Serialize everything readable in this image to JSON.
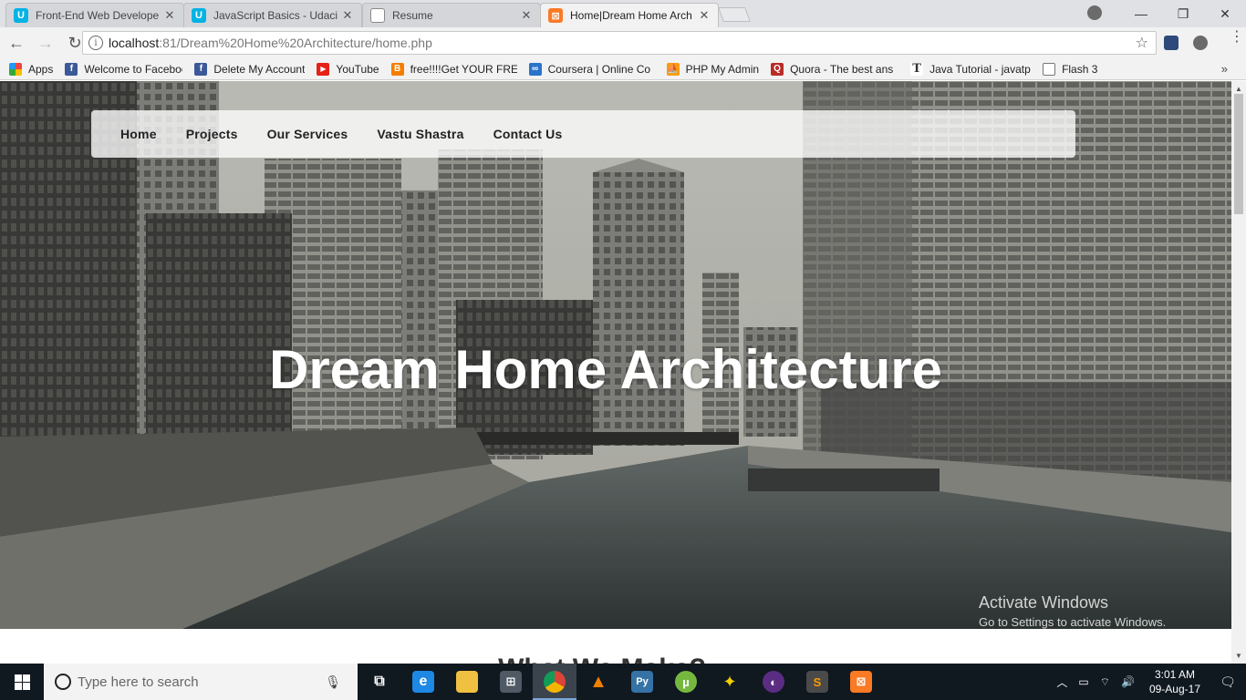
{
  "browser": {
    "tabs": [
      {
        "title": "Front-End Web Develope",
        "icon": "udacity-icon",
        "color": "#02b3e4"
      },
      {
        "title": "JavaScript Basics - Udaci",
        "icon": "udacity-icon",
        "color": "#02b3e4"
      },
      {
        "title": "Resume",
        "icon": "document-icon",
        "color": "#888888"
      },
      {
        "title": "Home|Dream Home Arch",
        "icon": "xampp-icon",
        "color": "#fb7a24"
      }
    ],
    "close_glyph": "✕",
    "window_controls": {
      "minimize": "—",
      "restore": "❐",
      "close": "✕"
    },
    "url_host": "localhost",
    "url_path": ":81/Dream%20Home%20Architecture/home.php",
    "info_glyph": "i",
    "star_glyph": "☆"
  },
  "bookmarks": [
    {
      "label": "Apps",
      "icon": "apps-grid-icon",
      "color": "#e44"
    },
    {
      "label": "Welcome to Faceboo",
      "icon": "facebook-icon",
      "color": "#3b5998"
    },
    {
      "label": "Delete My Account",
      "icon": "facebook-icon",
      "color": "#3b5998"
    },
    {
      "label": "YouTube",
      "icon": "youtube-icon",
      "color": "#e62117"
    },
    {
      "label": "free!!!!Get YOUR FRE",
      "icon": "blogger-icon",
      "color": "#f57d00"
    },
    {
      "label": "Coursera | Online Co",
      "icon": "coursera-icon",
      "color": "#2a73cc"
    },
    {
      "label": "PHP My Admin",
      "icon": "phpmyadmin-icon",
      "color": "#f89c0e"
    },
    {
      "label": "Quora - The best ans",
      "icon": "quora-icon",
      "color": "#b92b27"
    },
    {
      "label": "Java Tutorial - javatp",
      "icon": "javatpoint-icon",
      "color": "#555555"
    },
    {
      "label": "Flash 3",
      "icon": "document-icon",
      "color": "#888888"
    }
  ],
  "bookmarks_more": "»",
  "page": {
    "nav": [
      "Home",
      "Projects",
      "Our Services",
      "Vastu Shastra",
      "Contact Us"
    ],
    "hero_title": "Dream Home Architecture",
    "next_section_title": "What We Make?",
    "watermark_line1": "Activate Windows",
    "watermark_line2": "Go to Settings to activate Windows."
  },
  "taskbar": {
    "search_placeholder": "Type here to search",
    "apps": [
      {
        "name": "task-view-icon",
        "glyph": "⧉",
        "color": "#101820"
      },
      {
        "name": "edge-icon",
        "glyph": "e",
        "color": "#1e88e5"
      },
      {
        "name": "file-explorer-icon",
        "glyph": "▬",
        "color": "#f0c040"
      },
      {
        "name": "store-icon",
        "glyph": "⊞",
        "color": "#505a64"
      },
      {
        "name": "chrome-icon",
        "glyph": "◉",
        "color": "#db4437"
      },
      {
        "name": "vlc-icon",
        "glyph": "▲",
        "color": "#f08000"
      },
      {
        "name": "python-icon",
        "glyph": "Py",
        "color": "#3572a5"
      },
      {
        "name": "utorrent-icon",
        "glyph": "µ",
        "color": "#76b83f"
      },
      {
        "name": "magic-wand-icon",
        "glyph": "✦",
        "color": "#c9a800"
      },
      {
        "name": "eclipse-icon",
        "glyph": "◐",
        "color": "#5a2d82"
      },
      {
        "name": "sublime-icon",
        "glyph": "S",
        "color": "#4a4a4a"
      },
      {
        "name": "xampp-icon",
        "glyph": "⊠",
        "color": "#fb7a24"
      }
    ],
    "time": "3:01 AM",
    "date": "09-Aug-17"
  }
}
